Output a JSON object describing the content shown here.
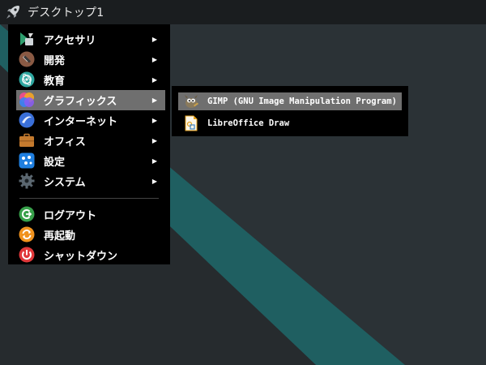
{
  "panel": {
    "title": "デスクトップ1",
    "launcher_icon": "rocket-icon"
  },
  "menu": {
    "items": [
      {
        "label": "アクセサリ",
        "icon": "accessories-icon",
        "has_submenu": true
      },
      {
        "label": "開発",
        "icon": "development-icon",
        "has_submenu": true
      },
      {
        "label": "教育",
        "icon": "education-icon",
        "has_submenu": true
      },
      {
        "label": "グラフィックス",
        "icon": "graphics-icon",
        "has_submenu": true,
        "selected": true
      },
      {
        "label": "インターネット",
        "icon": "internet-icon",
        "has_submenu": true
      },
      {
        "label": "オフィス",
        "icon": "office-icon",
        "has_submenu": true
      },
      {
        "label": "設定",
        "icon": "settings-icon",
        "has_submenu": true
      },
      {
        "label": "システム",
        "icon": "system-icon",
        "has_submenu": true
      }
    ],
    "session": [
      {
        "label": "ログアウト",
        "icon": "logout-icon"
      },
      {
        "label": "再起動",
        "icon": "reboot-icon"
      },
      {
        "label": "シャットダウン",
        "icon": "shutdown-icon"
      }
    ],
    "arrow": "▶"
  },
  "submenu": {
    "items": [
      {
        "label": "GIMP (GNU Image Manipulation Program)",
        "icon": "gimp-icon",
        "selected": true
      },
      {
        "label": "LibreOffice Draw",
        "icon": "libreoffice-draw-icon"
      }
    ]
  },
  "colors": {
    "panel": "#1a1d1f",
    "menu_bg": "#000000",
    "highlight": "#6f6f6f",
    "desktop": "#2b3134",
    "teal": "#1e5e60"
  }
}
